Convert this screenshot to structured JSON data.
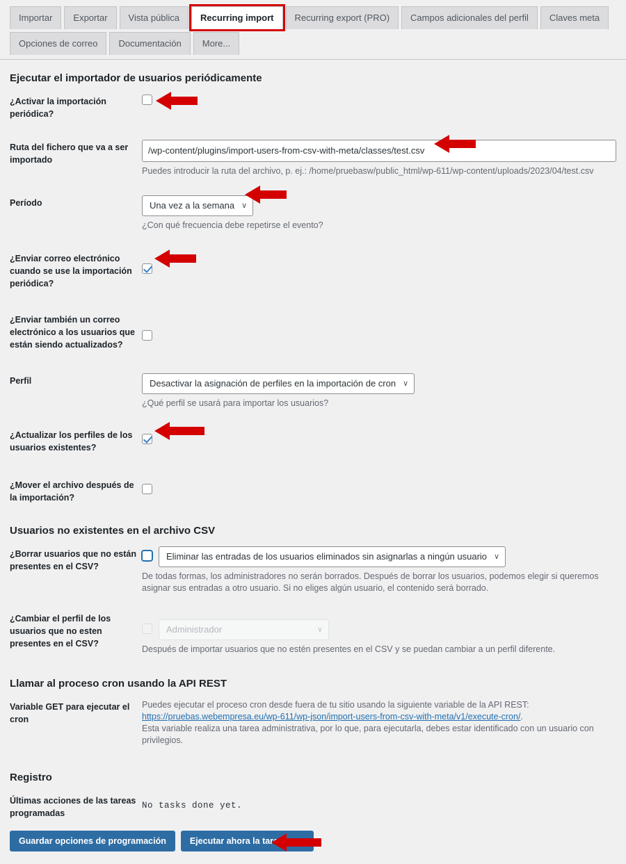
{
  "tabs": {
    "row1": [
      {
        "label": "Importar",
        "active": false
      },
      {
        "label": "Exportar",
        "active": false
      },
      {
        "label": "Vista pública",
        "active": false
      },
      {
        "label": "Recurring import",
        "active": true
      },
      {
        "label": "Recurring export (PRO)",
        "active": false
      },
      {
        "label": "Campos adicionales del perfil",
        "active": false
      },
      {
        "label": "Claves meta",
        "active": false
      }
    ],
    "row2": [
      {
        "label": "Opciones de correo",
        "active": false
      },
      {
        "label": "Documentación",
        "active": false
      },
      {
        "label": "More...",
        "active": false
      }
    ]
  },
  "sections": {
    "main_heading": "Ejecutar el importador de usuarios periódicamente",
    "csv_heading": "Usuarios no existentes en el archivo CSV",
    "rest_heading": "Llamar al proceso cron usando la API REST",
    "log_heading": "Registro"
  },
  "fields": {
    "activate": {
      "label": "¿Activar la importación periódica?",
      "checked": false
    },
    "path": {
      "label": "Ruta del fichero que va a ser importado",
      "value": "/wp-content/plugins/import-users-from-csv-with-meta/classes/test.csv",
      "desc": "Puedes introducir la ruta del archivo, p. ej.: /home/pruebasw/public_html/wp-611/wp-content/uploads/2023/04/test.csv"
    },
    "period": {
      "label": "Período",
      "value": "Una vez a la semana",
      "desc": "¿Con qué frecuencia debe repetirse el evento?"
    },
    "send_mail": {
      "label": "¿Enviar correo electrónico cuando se use la importación periódica?",
      "checked": true
    },
    "send_mail_users": {
      "label": "¿Enviar también un correo electrónico a los usuarios que están siendo actualizados?",
      "checked": false
    },
    "role": {
      "label": "Perfil",
      "value": "Desactivar la asignación de perfiles en la importación de cron",
      "desc": "¿Qué perfil se usará para importar los usuarios?"
    },
    "update_roles": {
      "label": "¿Actualizar los perfiles de los usuarios existentes?",
      "checked": true
    },
    "move_file": {
      "label": "¿Mover el archivo después de la importación?",
      "checked": false
    },
    "delete_users": {
      "label": "¿Borrar usuarios que no están presentes en el CSV?",
      "checked": false,
      "select_value": "Eliminar las entradas de los usuarios eliminados sin asignarlas a ningún usuario",
      "desc": "De todas formas, los administradores no serán borrados. Después de borrar los usuarios, podemos elegir si queremos asignar sus entradas a otro usuario. Si no eliges algún usuario, el contenido será borrado."
    },
    "change_role": {
      "label": "¿Cambiar el perfil de los usuarios que no esten presentes en el CSV?",
      "checked": false,
      "select_value": "Administrador",
      "desc": "Después de importar usuarios que no estén presentes en el CSV y se puedan cambiar a un perfil diferente."
    },
    "get_variable": {
      "label": "Variable GET para ejecutar el cron",
      "desc_before": "Puedes ejecutar el proceso cron desde fuera de tu sitio usando la siguiente variable de la API REST:",
      "link": "https://pruebas.webempresa.eu/wp-611/wp-json/import-users-from-csv-with-meta/v1/execute-cron/",
      "desc_after": "Esta variable realiza una tarea administrativa, por lo que, para ejecutarla, debes estar identificado con un usuario con privilegios."
    },
    "log": {
      "label": "Últimas acciones de las tareas programadas",
      "value": "No tasks done yet."
    }
  },
  "buttons": {
    "save": "Guardar opciones de programación",
    "run_now": "Ejecutar ahora la tarea cron"
  },
  "colors": {
    "accent": "#2e6da4",
    "annotation": "#d40000",
    "link": "#2271b1",
    "background": "#f0f0f1"
  },
  "icons": {
    "caret": "∨"
  }
}
